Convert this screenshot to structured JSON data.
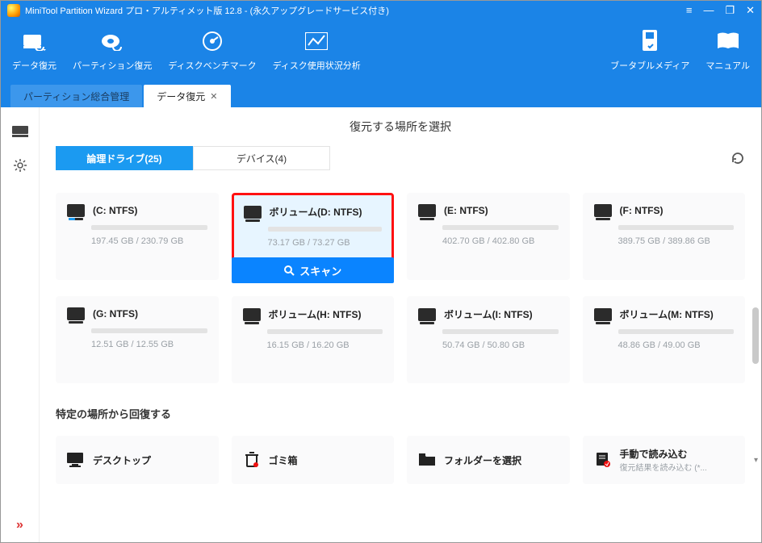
{
  "window": {
    "title": "MiniTool Partition Wizard プロ・アルティメット版 12.8 - (永久アップグレードサービス付き)"
  },
  "toolbar": {
    "data_recovery": "データ復元",
    "partition_recovery": "パーティション復元",
    "disk_benchmark": "ディスクベンチマーク",
    "disk_usage": "ディスク使用状況分析",
    "bootable_media": "ブータブルメディア",
    "manual": "マニュアル"
  },
  "tabs": {
    "partition_mgmt": "パーティション総合管理",
    "data_recovery": "データ復元"
  },
  "heading": "復元する場所を選択",
  "mode": {
    "logical": "論理ドライブ(25)",
    "device": "デバイス(4)"
  },
  "drives": [
    {
      "name": "(C: NTFS)",
      "size": "197.45 GB / 230.79 GB"
    },
    {
      "name": "ボリューム(D: NTFS)",
      "size": "73.17 GB / 73.27 GB"
    },
    {
      "name": "(E: NTFS)",
      "size": "402.70 GB / 402.80 GB"
    },
    {
      "name": "(F: NTFS)",
      "size": "389.75 GB / 389.86 GB"
    },
    {
      "name": "(G: NTFS)",
      "size": "12.51 GB / 12.55 GB"
    },
    {
      "name": "ボリューム(H: NTFS)",
      "size": "16.15 GB / 16.20 GB"
    },
    {
      "name": "ボリューム(I: NTFS)",
      "size": "50.74 GB / 50.80 GB"
    },
    {
      "name": "ボリューム(M: NTFS)",
      "size": "48.86 GB / 49.00 GB"
    }
  ],
  "scan_label": "スキャン",
  "section_title": "特定の場所から回復する",
  "locations": {
    "desktop": "デスクトップ",
    "trash": "ゴミ箱",
    "folder": "フォルダーを選択",
    "manual_load": "手動で読み込む",
    "manual_load_sub": "復元結果を読み込む (*..."
  }
}
